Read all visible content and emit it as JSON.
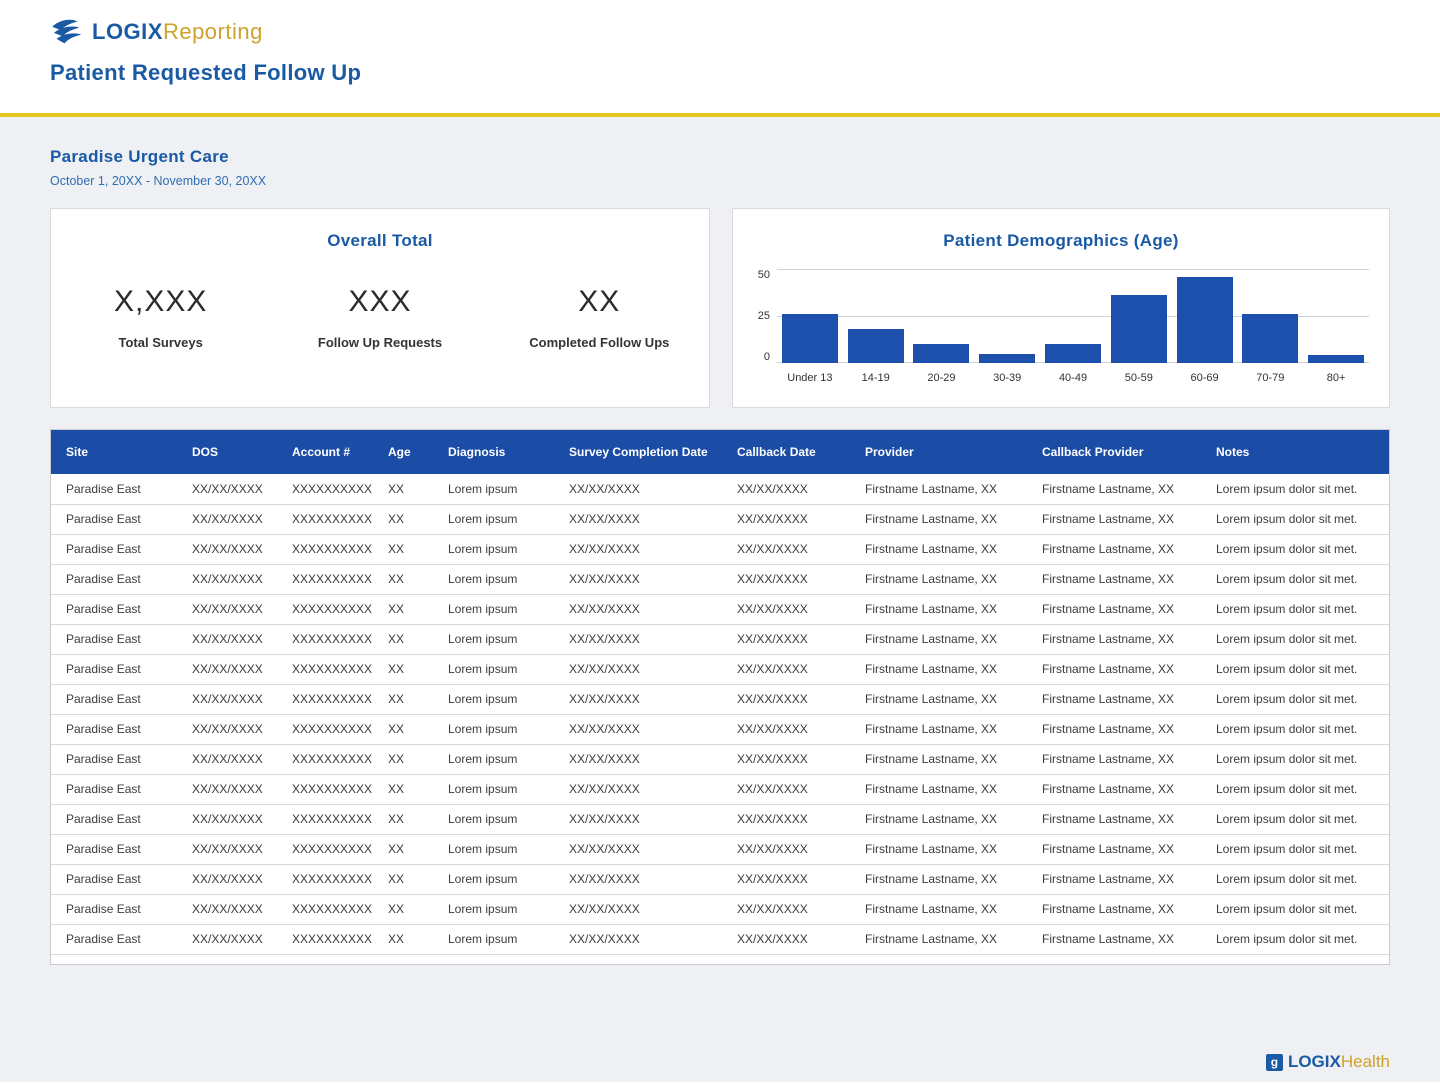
{
  "header": {
    "logo_part1": "LOGIX",
    "logo_part2": "Reporting",
    "page_title": "Patient Requested Follow Up"
  },
  "report": {
    "facility": "Paradise Urgent Care",
    "date_range": "October 1, 20XX - November 30, 20XX"
  },
  "overall_total": {
    "title": "Overall Total",
    "stats": [
      {
        "value": "X,XXX",
        "label": "Total Surveys"
      },
      {
        "value": "XXX",
        "label": "Follow Up Requests"
      },
      {
        "value": "XX",
        "label": "Completed Follow Ups"
      }
    ]
  },
  "chart_data": {
    "type": "bar",
    "title": "Patient Demographics (Age)",
    "categories": [
      "Under 13",
      "14-19",
      "20-29",
      "30-39",
      "40-49",
      "50-59",
      "60-69",
      "70-79",
      "80+"
    ],
    "values": [
      26,
      18,
      10,
      5,
      10,
      36,
      46,
      26,
      4
    ],
    "xlabel": "",
    "ylabel": "",
    "ylim": [
      0,
      50
    ],
    "yticks": [
      0,
      25,
      50
    ],
    "grid": true,
    "legend": false,
    "bar_color": "#1d50ad"
  },
  "table": {
    "columns": [
      "Site",
      "DOS",
      "Account #",
      "Age",
      "Diagnosis",
      "Survey Completion Date",
      "Callback Date",
      "Provider",
      "Callback Provider",
      "Notes"
    ],
    "rows": [
      [
        "Paradise East",
        "XX/XX/XXXX",
        "XXXXXXXXXX",
        "XX",
        "Lorem ipsum",
        "XX/XX/XXXX",
        "XX/XX/XXXX",
        "Firstname Lastname, XX",
        "Firstname Lastname, XX",
        "Lorem ipsum dolor sit met."
      ],
      [
        "Paradise East",
        "XX/XX/XXXX",
        "XXXXXXXXXX",
        "XX",
        "Lorem ipsum",
        "XX/XX/XXXX",
        "XX/XX/XXXX",
        "Firstname Lastname, XX",
        "Firstname Lastname, XX",
        "Lorem ipsum dolor sit met."
      ],
      [
        "Paradise East",
        "XX/XX/XXXX",
        "XXXXXXXXXX",
        "XX",
        "Lorem ipsum",
        "XX/XX/XXXX",
        "XX/XX/XXXX",
        "Firstname Lastname, XX",
        "Firstname Lastname, XX",
        "Lorem ipsum dolor sit met."
      ],
      [
        "Paradise East",
        "XX/XX/XXXX",
        "XXXXXXXXXX",
        "XX",
        "Lorem ipsum",
        "XX/XX/XXXX",
        "XX/XX/XXXX",
        "Firstname Lastname, XX",
        "Firstname Lastname, XX",
        "Lorem ipsum dolor sit met."
      ],
      [
        "Paradise East",
        "XX/XX/XXXX",
        "XXXXXXXXXX",
        "XX",
        "Lorem ipsum",
        "XX/XX/XXXX",
        "XX/XX/XXXX",
        "Firstname Lastname, XX",
        "Firstname Lastname, XX",
        "Lorem ipsum dolor sit met."
      ],
      [
        "Paradise East",
        "XX/XX/XXXX",
        "XXXXXXXXXX",
        "XX",
        "Lorem ipsum",
        "XX/XX/XXXX",
        "XX/XX/XXXX",
        "Firstname Lastname, XX",
        "Firstname Lastname, XX",
        "Lorem ipsum dolor sit met."
      ],
      [
        "Paradise East",
        "XX/XX/XXXX",
        "XXXXXXXXXX",
        "XX",
        "Lorem ipsum",
        "XX/XX/XXXX",
        "XX/XX/XXXX",
        "Firstname Lastname, XX",
        "Firstname Lastname, XX",
        "Lorem ipsum dolor sit met."
      ],
      [
        "Paradise East",
        "XX/XX/XXXX",
        "XXXXXXXXXX",
        "XX",
        "Lorem ipsum",
        "XX/XX/XXXX",
        "XX/XX/XXXX",
        "Firstname Lastname, XX",
        "Firstname Lastname, XX",
        "Lorem ipsum dolor sit met."
      ],
      [
        "Paradise East",
        "XX/XX/XXXX",
        "XXXXXXXXXX",
        "XX",
        "Lorem ipsum",
        "XX/XX/XXXX",
        "XX/XX/XXXX",
        "Firstname Lastname, XX",
        "Firstname Lastname, XX",
        "Lorem ipsum dolor sit met."
      ],
      [
        "Paradise East",
        "XX/XX/XXXX",
        "XXXXXXXXXX",
        "XX",
        "Lorem ipsum",
        "XX/XX/XXXX",
        "XX/XX/XXXX",
        "Firstname Lastname, XX",
        "Firstname Lastname, XX",
        "Lorem ipsum dolor sit met."
      ],
      [
        "Paradise East",
        "XX/XX/XXXX",
        "XXXXXXXXXX",
        "XX",
        "Lorem ipsum",
        "XX/XX/XXXX",
        "XX/XX/XXXX",
        "Firstname Lastname, XX",
        "Firstname Lastname, XX",
        "Lorem ipsum dolor sit met."
      ],
      [
        "Paradise East",
        "XX/XX/XXXX",
        "XXXXXXXXXX",
        "XX",
        "Lorem ipsum",
        "XX/XX/XXXX",
        "XX/XX/XXXX",
        "Firstname Lastname, XX",
        "Firstname Lastname, XX",
        "Lorem ipsum dolor sit met."
      ],
      [
        "Paradise East",
        "XX/XX/XXXX",
        "XXXXXXXXXX",
        "XX",
        "Lorem ipsum",
        "XX/XX/XXXX",
        "XX/XX/XXXX",
        "Firstname Lastname, XX",
        "Firstname Lastname, XX",
        "Lorem ipsum dolor sit met."
      ],
      [
        "Paradise East",
        "XX/XX/XXXX",
        "XXXXXXXXXX",
        "XX",
        "Lorem ipsum",
        "XX/XX/XXXX",
        "XX/XX/XXXX",
        "Firstname Lastname, XX",
        "Firstname Lastname, XX",
        "Lorem ipsum dolor sit met."
      ],
      [
        "Paradise East",
        "XX/XX/XXXX",
        "XXXXXXXXXX",
        "XX",
        "Lorem ipsum",
        "XX/XX/XXXX",
        "XX/XX/XXXX",
        "Firstname Lastname, XX",
        "Firstname Lastname, XX",
        "Lorem ipsum dolor sit met."
      ],
      [
        "Paradise East",
        "XX/XX/XXXX",
        "XXXXXXXXXX",
        "XX",
        "Lorem ipsum",
        "XX/XX/XXXX",
        "XX/XX/XXXX",
        "Firstname Lastname, XX",
        "Firstname Lastname, XX",
        "Lorem ipsum dolor sit met."
      ]
    ]
  },
  "footer": {
    "logo_part1": "LOGIX",
    "logo_part2": "Health"
  },
  "colors": {
    "brand_blue": "#1a5aa5",
    "brand_gold": "#cfa22b",
    "divider_yellow": "#e5c41c",
    "table_header_blue": "#1c4da6",
    "bar_blue": "#1d50ad"
  }
}
